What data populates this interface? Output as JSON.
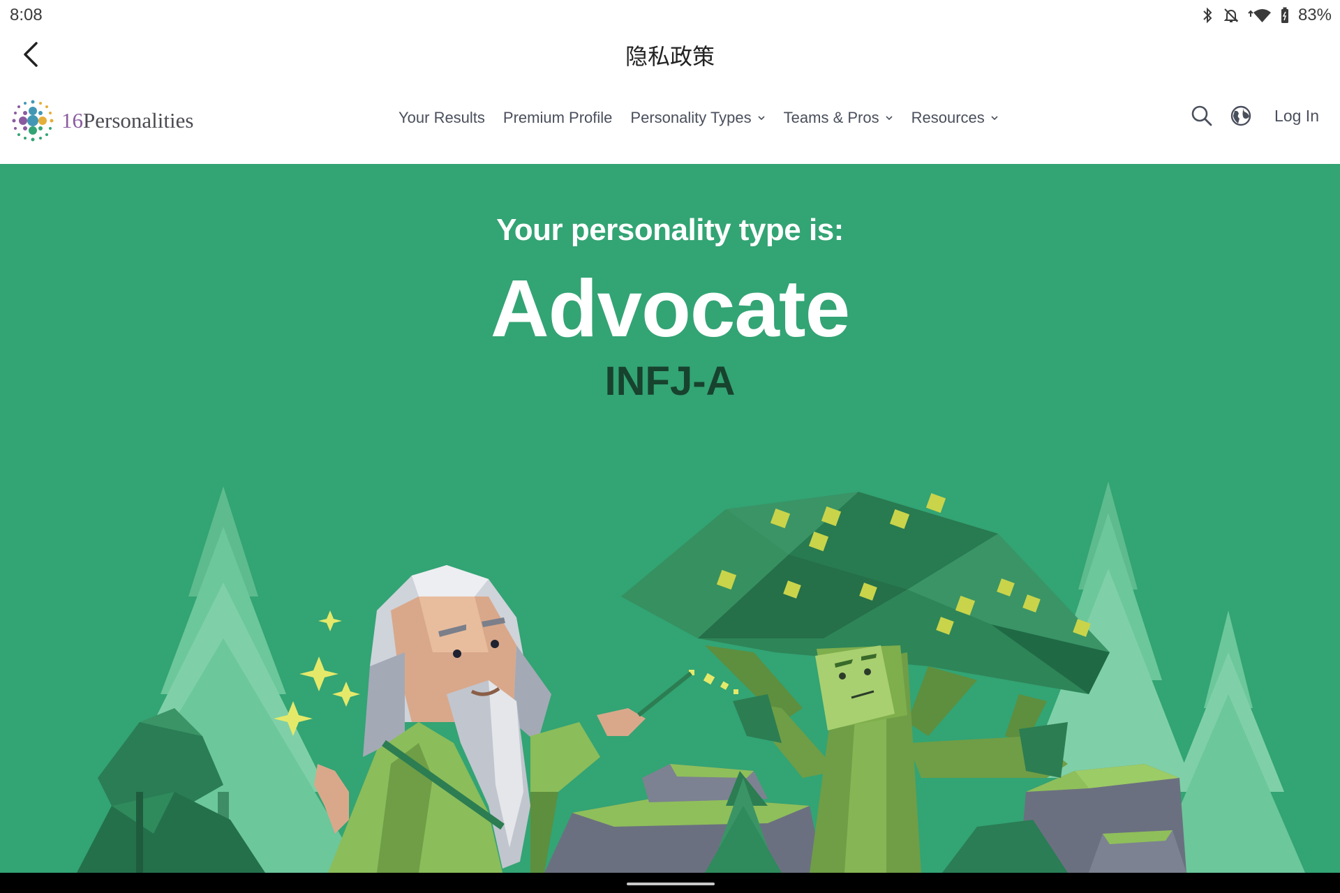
{
  "status_bar": {
    "time": "8:08",
    "battery": "83%",
    "icons": [
      "bluetooth-icon",
      "bell-off-icon",
      "wifi-icon",
      "battery-icon"
    ]
  },
  "app_bar": {
    "title": "隐私政策",
    "back_icon": "back-arrow-icon"
  },
  "site_nav": {
    "logo": {
      "num": "16",
      "name": "Personalities"
    },
    "links": [
      {
        "label": "Your Results",
        "dropdown": false
      },
      {
        "label": "Premium Profile",
        "dropdown": false
      },
      {
        "label": "Personality Types",
        "dropdown": true
      },
      {
        "label": "Teams & Pros",
        "dropdown": true
      },
      {
        "label": "Resources",
        "dropdown": true
      }
    ],
    "login_label": "Log In",
    "icons": [
      "search-icon",
      "globe-icon"
    ]
  },
  "hero": {
    "subtitle": "Your personality type is:",
    "type_name": "Advocate",
    "type_code": "INFJ-A",
    "background": "#33a474",
    "code_color": "#17422e"
  }
}
